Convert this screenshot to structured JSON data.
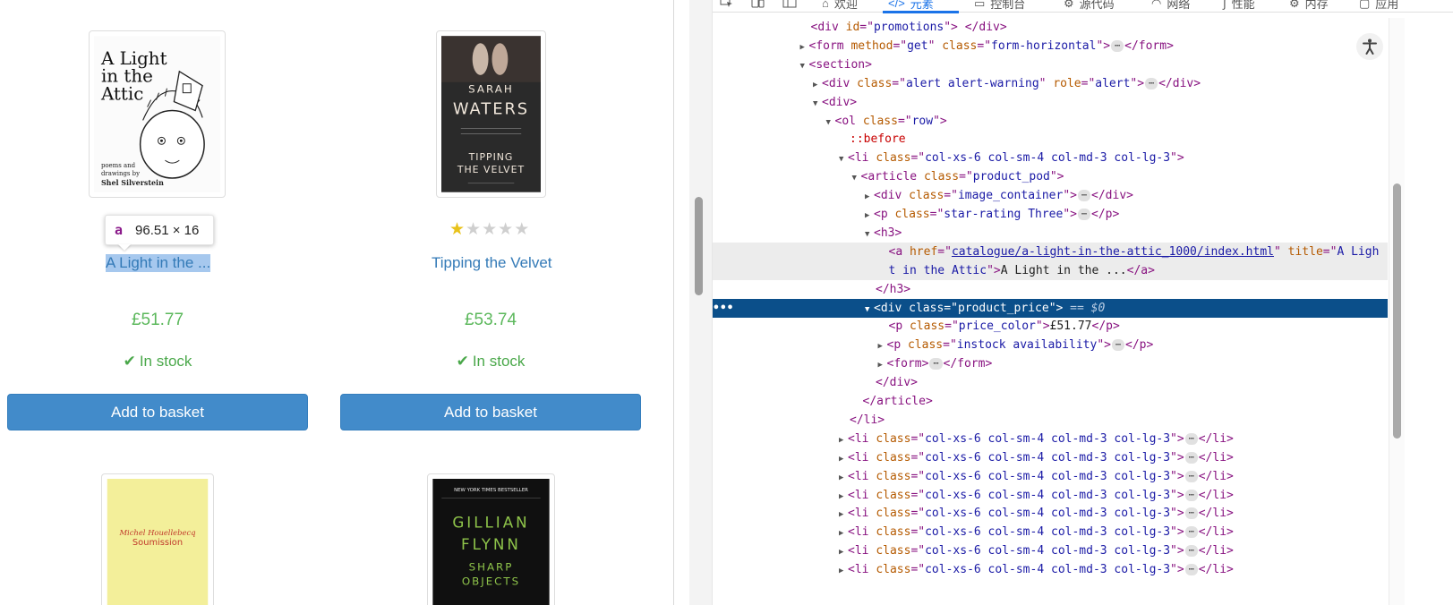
{
  "products": [
    {
      "title": "A Light in the ...",
      "price": "£51.77",
      "stock": "In stock",
      "button": "Add to basket",
      "rating": 3
    },
    {
      "title": "Tipping the Velvet",
      "price": "£53.74",
      "stock": "In stock",
      "button": "Add to basket",
      "rating": 1
    }
  ],
  "covers": {
    "light_attic": {
      "line1": "A Light",
      "line2": "in the",
      "line3": "Attic",
      "sub1": "poems and",
      "sub2": "drawings by",
      "author": "Shel Silverstein"
    },
    "tipping": {
      "author1": "SARAH",
      "author2": "WATERS",
      "title1": "TIPPING",
      "title2": "THE VELVET"
    },
    "soumission": {
      "author": "Michel Houellebecq",
      "title": "Soumission"
    },
    "sharp": {
      "banner": "NEW YORK TIMES BESTSELLER",
      "author1": "GILLIAN",
      "author2": "FLYNN",
      "title1": "SHARP",
      "title2": "OBJECTS"
    }
  },
  "tooltip": {
    "tag": "a",
    "size": "96.51 × 16"
  },
  "devtools": {
    "tabs": [
      "欢迎",
      "元素",
      "控制台",
      "源代码",
      "网络",
      "性能",
      "内存",
      "应用"
    ],
    "eq_label": "== $0",
    "lines": [
      {
        "indent": 7,
        "parts": [
          [
            "tag",
            "<div "
          ],
          [
            "attr",
            "id"
          ],
          [
            "tag",
            "=\""
          ],
          [
            "val",
            "promotions"
          ],
          [
            "tag",
            "\"> </div>"
          ]
        ]
      },
      {
        "indent": 7,
        "tri": "▶",
        "parts": [
          [
            "tag",
            "<form "
          ],
          [
            "attr",
            "method"
          ],
          [
            "tag",
            "=\""
          ],
          [
            "val",
            "get"
          ],
          [
            "tag",
            "\" "
          ],
          [
            "attr",
            "class"
          ],
          [
            "tag",
            "=\""
          ],
          [
            "val",
            "form-horizontal"
          ],
          [
            "tag",
            "\">"
          ],
          [
            "ell",
            "⋯"
          ],
          [
            "tag",
            "</form>"
          ]
        ]
      },
      {
        "indent": 7,
        "tri": "▼",
        "parts": [
          [
            "tag",
            "<section>"
          ]
        ]
      },
      {
        "indent": 8,
        "tri": "▶",
        "parts": [
          [
            "tag",
            "<div "
          ],
          [
            "attr",
            "class"
          ],
          [
            "tag",
            "=\""
          ],
          [
            "val",
            "alert alert-warning"
          ],
          [
            "tag",
            "\" "
          ],
          [
            "attr",
            "role"
          ],
          [
            "tag",
            "=\""
          ],
          [
            "val",
            "alert"
          ],
          [
            "tag",
            "\">"
          ],
          [
            "ell",
            "⋯"
          ],
          [
            "tag",
            "</div>"
          ]
        ]
      },
      {
        "indent": 8,
        "tri": "▼",
        "parts": [
          [
            "tag",
            "<div>"
          ]
        ]
      },
      {
        "indent": 9,
        "tri": "▼",
        "parts": [
          [
            "tag",
            "<ol "
          ],
          [
            "attr",
            "class"
          ],
          [
            "tag",
            "=\""
          ],
          [
            "val",
            "row"
          ],
          [
            "tag",
            "\">"
          ]
        ]
      },
      {
        "indent": 10,
        "parts": [
          [
            "pseudo",
            "::before"
          ]
        ]
      },
      {
        "indent": 10,
        "tri": "▼",
        "parts": [
          [
            "tag",
            "<li "
          ],
          [
            "attr",
            "class"
          ],
          [
            "tag",
            "=\""
          ],
          [
            "val",
            "col-xs-6 col-sm-4 col-md-3 col-lg-3"
          ],
          [
            "tag",
            "\">"
          ]
        ]
      },
      {
        "indent": 11,
        "tri": "▼",
        "parts": [
          [
            "tag",
            "<article "
          ],
          [
            "attr",
            "class"
          ],
          [
            "tag",
            "=\""
          ],
          [
            "val",
            "product_pod"
          ],
          [
            "tag",
            "\">"
          ]
        ]
      },
      {
        "indent": 12,
        "tri": "▶",
        "parts": [
          [
            "tag",
            "<div "
          ],
          [
            "attr",
            "class"
          ],
          [
            "tag",
            "=\""
          ],
          [
            "val",
            "image_container"
          ],
          [
            "tag",
            "\">"
          ],
          [
            "ell",
            "⋯"
          ],
          [
            "tag",
            "</div>"
          ]
        ]
      },
      {
        "indent": 12,
        "tri": "▶",
        "parts": [
          [
            "tag",
            "<p "
          ],
          [
            "attr",
            "class"
          ],
          [
            "tag",
            "=\""
          ],
          [
            "val",
            "star-rating Three"
          ],
          [
            "tag",
            "\">"
          ],
          [
            "ell",
            "⋯"
          ],
          [
            "tag",
            "</p>"
          ]
        ]
      },
      {
        "indent": 12,
        "tri": "▼",
        "parts": [
          [
            "tag",
            "<h3>"
          ]
        ]
      },
      {
        "indent": 13,
        "cls": "hover",
        "parts": [
          [
            "tag",
            "<a "
          ],
          [
            "attr",
            "href"
          ],
          [
            "tag",
            "=\""
          ],
          [
            "link",
            "catalogue/a-light-in-the-attic_1000/index.html"
          ],
          [
            "tag",
            "\" "
          ],
          [
            "attr",
            "title"
          ],
          [
            "tag",
            "=\""
          ],
          [
            "val",
            "A Ligh"
          ]
        ]
      },
      {
        "indent": 13,
        "cls": "hover",
        "parts": [
          [
            "val",
            "t in the Attic"
          ],
          [
            "tag",
            "\">"
          ],
          [
            "txt",
            "A Light in the ..."
          ],
          [
            "tag",
            "</a>"
          ]
        ]
      },
      {
        "indent": 12,
        "parts": [
          [
            "tag",
            "</h3>"
          ]
        ]
      },
      {
        "indent": 12,
        "tri": "▼",
        "cls": "current",
        "eq": true,
        "parts": [
          [
            "tag",
            "<div "
          ],
          [
            "attr",
            "class"
          ],
          [
            "tag",
            "=\""
          ],
          [
            "val",
            "product_price"
          ],
          [
            "tag",
            "\">"
          ]
        ]
      },
      {
        "indent": 13,
        "parts": [
          [
            "tag",
            "<p "
          ],
          [
            "attr",
            "class"
          ],
          [
            "tag",
            "=\""
          ],
          [
            "val",
            "price_color"
          ],
          [
            "tag",
            "\">"
          ],
          [
            "txt",
            "£51.77"
          ],
          [
            "tag",
            "</p>"
          ]
        ]
      },
      {
        "indent": 13,
        "tri": "▶",
        "parts": [
          [
            "tag",
            "<p "
          ],
          [
            "attr",
            "class"
          ],
          [
            "tag",
            "=\""
          ],
          [
            "val",
            "instock availability"
          ],
          [
            "tag",
            "\">"
          ],
          [
            "ell",
            "⋯"
          ],
          [
            "tag",
            "</p>"
          ]
        ]
      },
      {
        "indent": 13,
        "tri": "▶",
        "parts": [
          [
            "tag",
            "<form>"
          ],
          [
            "ell",
            "⋯"
          ],
          [
            "tag",
            "</form>"
          ]
        ]
      },
      {
        "indent": 12,
        "parts": [
          [
            "tag",
            "</div>"
          ]
        ]
      },
      {
        "indent": 11,
        "parts": [
          [
            "tag",
            "</article>"
          ]
        ]
      },
      {
        "indent": 10,
        "parts": [
          [
            "tag",
            "</li>"
          ]
        ]
      },
      {
        "indent": 10,
        "tri": "▶",
        "parts": [
          [
            "tag",
            "<li "
          ],
          [
            "attr",
            "class"
          ],
          [
            "tag",
            "=\""
          ],
          [
            "val",
            "col-xs-6 col-sm-4 col-md-3 col-lg-3"
          ],
          [
            "tag",
            "\">"
          ],
          [
            "ell",
            "⋯"
          ],
          [
            "tag",
            "</li>"
          ]
        ]
      },
      {
        "indent": 10,
        "tri": "▶",
        "parts": [
          [
            "tag",
            "<li "
          ],
          [
            "attr",
            "class"
          ],
          [
            "tag",
            "=\""
          ],
          [
            "val",
            "col-xs-6 col-sm-4 col-md-3 col-lg-3"
          ],
          [
            "tag",
            "\">"
          ],
          [
            "ell",
            "⋯"
          ],
          [
            "tag",
            "</li>"
          ]
        ]
      },
      {
        "indent": 10,
        "tri": "▶",
        "parts": [
          [
            "tag",
            "<li "
          ],
          [
            "attr",
            "class"
          ],
          [
            "tag",
            "=\""
          ],
          [
            "val",
            "col-xs-6 col-sm-4 col-md-3 col-lg-3"
          ],
          [
            "tag",
            "\">"
          ],
          [
            "ell",
            "⋯"
          ],
          [
            "tag",
            "</li>"
          ]
        ]
      },
      {
        "indent": 10,
        "tri": "▶",
        "parts": [
          [
            "tag",
            "<li "
          ],
          [
            "attr",
            "class"
          ],
          [
            "tag",
            "=\""
          ],
          [
            "val",
            "col-xs-6 col-sm-4 col-md-3 col-lg-3"
          ],
          [
            "tag",
            "\">"
          ],
          [
            "ell",
            "⋯"
          ],
          [
            "tag",
            "</li>"
          ]
        ]
      },
      {
        "indent": 10,
        "tri": "▶",
        "parts": [
          [
            "tag",
            "<li "
          ],
          [
            "attr",
            "class"
          ],
          [
            "tag",
            "=\""
          ],
          [
            "val",
            "col-xs-6 col-sm-4 col-md-3 col-lg-3"
          ],
          [
            "tag",
            "\">"
          ],
          [
            "ell",
            "⋯"
          ],
          [
            "tag",
            "</li>"
          ]
        ]
      },
      {
        "indent": 10,
        "tri": "▶",
        "parts": [
          [
            "tag",
            "<li "
          ],
          [
            "attr",
            "class"
          ],
          [
            "tag",
            "=\""
          ],
          [
            "val",
            "col-xs-6 col-sm-4 col-md-3 col-lg-3"
          ],
          [
            "tag",
            "\">"
          ],
          [
            "ell",
            "⋯"
          ],
          [
            "tag",
            "</li>"
          ]
        ]
      },
      {
        "indent": 10,
        "tri": "▶",
        "parts": [
          [
            "tag",
            "<li "
          ],
          [
            "attr",
            "class"
          ],
          [
            "tag",
            "=\""
          ],
          [
            "val",
            "col-xs-6 col-sm-4 col-md-3 col-lg-3"
          ],
          [
            "tag",
            "\">"
          ],
          [
            "ell",
            "⋯"
          ],
          [
            "tag",
            "</li>"
          ]
        ]
      },
      {
        "indent": 10,
        "tri": "▶",
        "parts": [
          [
            "tag",
            "<li "
          ],
          [
            "attr",
            "class"
          ],
          [
            "tag",
            "=\""
          ],
          [
            "val",
            "col-xs-6 col-sm-4 col-md-3 col-lg-3"
          ],
          [
            "tag",
            "\">"
          ],
          [
            "ell",
            "⋯"
          ],
          [
            "tag",
            "</li>"
          ]
        ]
      }
    ]
  }
}
